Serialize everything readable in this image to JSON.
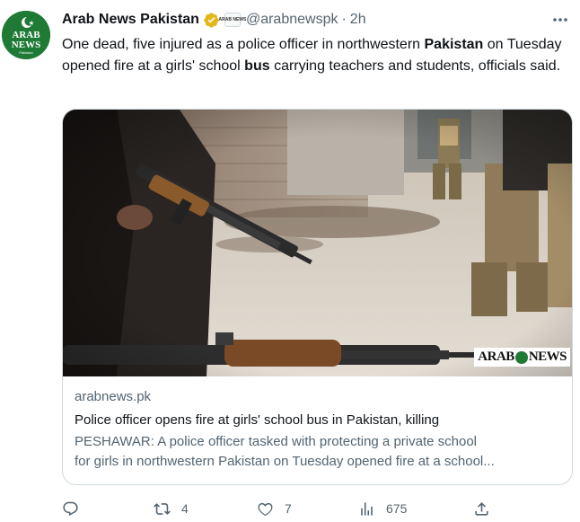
{
  "author": {
    "display_name": "Arab News Pakistan",
    "handle": "@arabnewspk",
    "separator": "·",
    "time": "2h",
    "avatar_text": [
      "ARAB",
      "NEWS",
      "Pakistan"
    ],
    "affiliate_badge_text": "ARAB NEWS"
  },
  "tweet": {
    "text_parts": [
      "One dead, five injured as a police officer in northwestern ",
      "Pakistan",
      " on Tuesday opened fire at a girls' school ",
      "bus",
      " carrying teachers and students, officials said."
    ]
  },
  "card": {
    "watermark": {
      "left": "ARAB",
      "right": "NEWS"
    },
    "domain": "arabnews.pk",
    "title": "Police officer opens fire at girls' school bus in Pakistan, killing",
    "description_lines": [
      "PESHAWAR: A police officer tasked with protecting a private school",
      "for girls in northwestern Pakistan on Tuesday opened fire at a school..."
    ]
  },
  "actions": {
    "reply_count": "",
    "retweet_count": "4",
    "like_count": "7",
    "views_count": "675"
  },
  "colors": {
    "text_primary": "#0f1419",
    "text_secondary": "#536471",
    "border": "#cfd9de",
    "verified_gold": "#e2b719",
    "brand_green": "#1e7a35"
  },
  "icons": [
    "more-icon",
    "verified-gold-icon",
    "reply-icon",
    "retweet-icon",
    "like-icon",
    "views-icon",
    "share-icon"
  ]
}
